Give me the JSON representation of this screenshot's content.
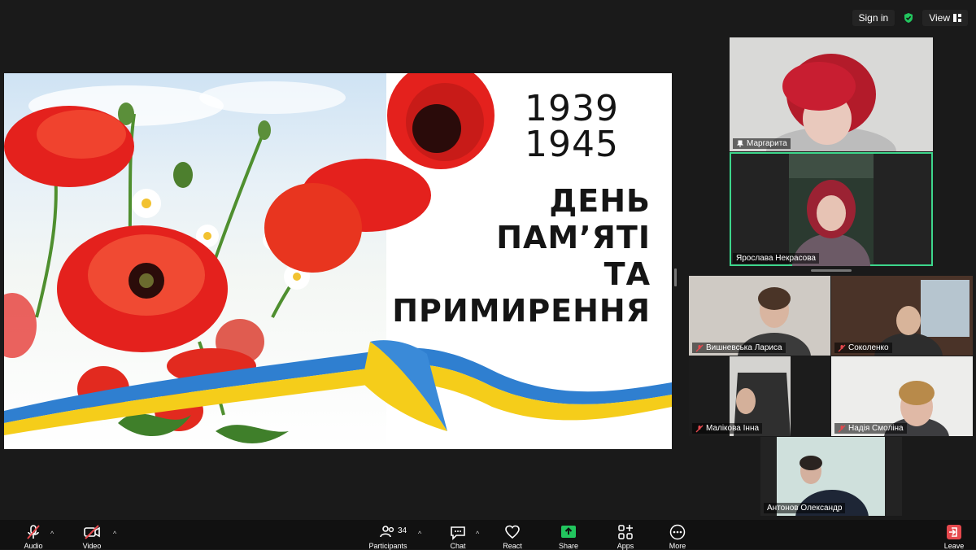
{
  "topbar": {
    "sign_in": "Sign in",
    "view": "View"
  },
  "slide": {
    "year_start": "1939",
    "year_end": "1945",
    "title_line1": "ДЕНЬ",
    "title_line2": "ПАМ’ЯТІ",
    "title_line3": "ТА",
    "title_line4": "ПРИМИРЕННЯ"
  },
  "participants_panel": [
    {
      "name": "Маргарита"
    },
    {
      "name": "Ярослава Некрасова"
    },
    {
      "name": "Вишневська Лариса"
    },
    {
      "name": "Соколенко"
    },
    {
      "name": "Малікова Інна"
    },
    {
      "name": "Надія Смоліна"
    },
    {
      "name": "Антонов Олександр"
    }
  ],
  "toolbar": {
    "audio": "Audio",
    "video": "Video",
    "participants": "Participants",
    "participants_count": "34",
    "chat": "Chat",
    "react": "React",
    "share": "Share",
    "apps": "Apps",
    "more": "More",
    "leave": "Leave"
  },
  "colors": {
    "active_speaker": "#3dd68c",
    "share_green": "#22c55e",
    "muted_red": "#e5484d",
    "poppy_red": "#e4211d"
  }
}
